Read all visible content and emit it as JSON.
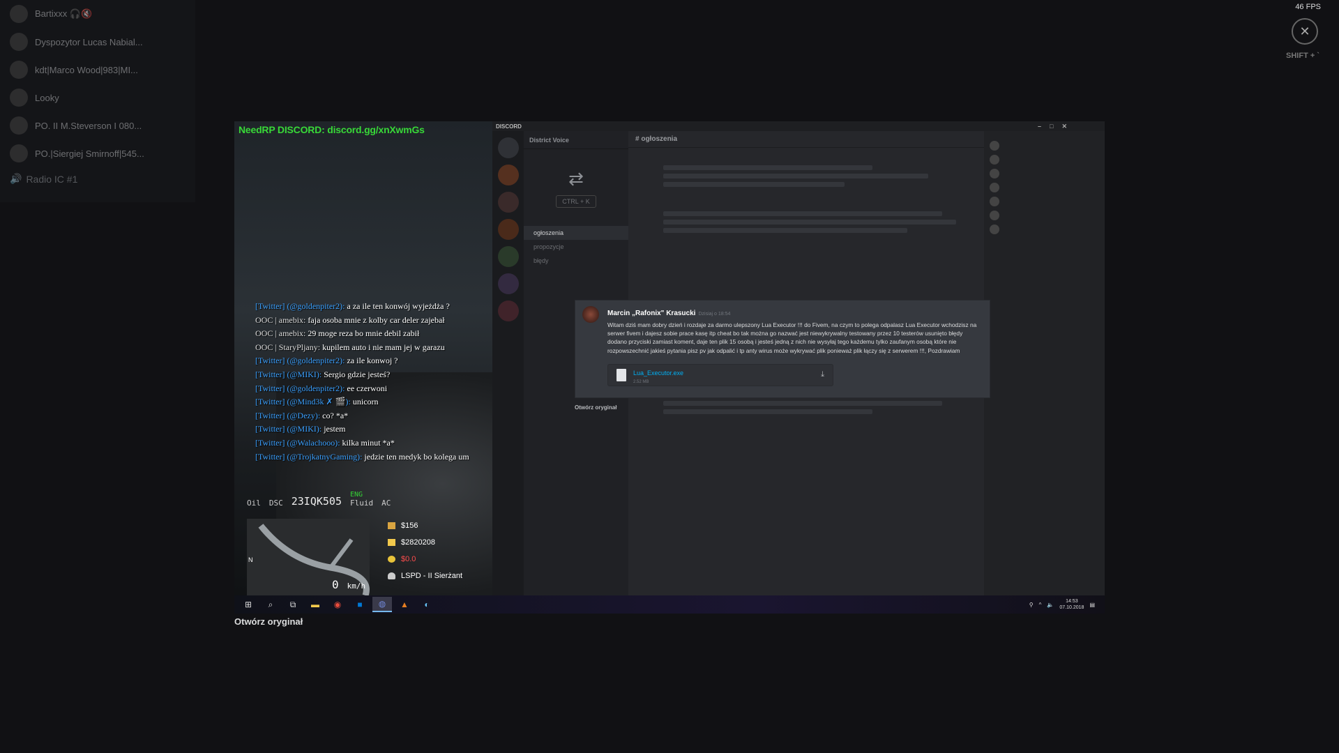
{
  "overlay": {
    "fps": "46 FPS",
    "shift_hint": "SHIFT + `",
    "close_symbol": "✕"
  },
  "voice": {
    "users": [
      {
        "name": "Bartixxx 🎧🔇"
      },
      {
        "name": "Dyspozytor Lucas Nabial..."
      },
      {
        "name": "kdt|Marco Wood|983|MI..."
      },
      {
        "name": "Looky"
      },
      {
        "name": "PO. II M.Steverson I 080..."
      },
      {
        "name": "PO.|Siergiej Smirnoff|545..."
      }
    ],
    "channel": "Radio IC #1"
  },
  "game": {
    "banner": "NeedRP DISCORD: discord.gg/xnXwmGs",
    "chat": [
      {
        "prefix": "[Twitter] (@goldenpiter2):",
        "text": "a za ile ten konwój wyjeżdża ?",
        "type": "tw"
      },
      {
        "prefix": "OOC | amebix:",
        "text": "faja osoba mnie z kolby car deler zajebał",
        "type": "ooc"
      },
      {
        "prefix": "OOC | amebix:",
        "text": "29 moge reza bo mnie debil zabił",
        "type": "ooc"
      },
      {
        "prefix": "OOC | StaryPljany:",
        "text": "kupilem auto i nie mam jej w garazu",
        "type": "ooc"
      },
      {
        "prefix": "[Twitter] (@goldenpiter2):",
        "text": "za ile konwoj ?",
        "type": "tw"
      },
      {
        "prefix": "[Twitter] (@MIKI):",
        "text": "Sergio gdzie jesteś?",
        "type": "tw"
      },
      {
        "prefix": "[Twitter] (@goldenpiter2):",
        "text": "ee czerwoni",
        "type": "tw"
      },
      {
        "prefix": "[Twitter] (@Mind3k ✗ 🎬):",
        "text": "unicorn",
        "type": "tw"
      },
      {
        "prefix": "[Twitter] (@Dezy):",
        "text": "co? *a*",
        "type": "tw"
      },
      {
        "prefix": "[Twitter] (@MIKI):",
        "text": "jestem",
        "type": "tw"
      },
      {
        "prefix": "[Twitter] (@Walachooo):",
        "text": "kilka minut *a*",
        "type": "tw"
      },
      {
        "prefix": "[Twitter] (@TrojkatnyGaming):",
        "text": "jedzie ten medyk bo kolega um",
        "type": "tw"
      }
    ],
    "hud": {
      "oil": "Oil",
      "dsc": "DSC",
      "plate": "23IQK505",
      "eng": "ENG",
      "fluid": "Fluid",
      "ac": "AC",
      "speed": "0",
      "speed_unit": "km/h",
      "compass": "N",
      "cash": "$156",
      "bank": "$2820208",
      "dirty": "$0.0",
      "job": "LSPD - II Sierżant",
      "colors": {
        "cash": "#d9a441",
        "bank": "#f2c94c",
        "dirty": "#ff4d4d"
      }
    }
  },
  "discord": {
    "app_label": "DISCORD",
    "server_name": "District Voice",
    "active_channel": "ogłoszenia",
    "channels": [
      "ogłoszenia",
      "propozycje",
      "błędy"
    ],
    "quick_switcher_shortcut": "CTRL + K"
  },
  "popup": {
    "author": "Marcin „Rafonix\" Krasucki",
    "timestamp": "Dzisiaj o 18:54",
    "body": "Witam dziś mam dobry dzień i rozdaje za darmo ulepszony Lua Executor !!! do Fivem, na czym to polega odpalasz Lua Executor wchodzisz na serwer fivem i dajesz sobie prace kasę itp cheat bo tak można go nazwać jest niewykrywalny testowany przez 10 testerów usunięto błędy dodano przyciski zamiast koment, daje ten plik 15 osobą i jesteś jedną z nich nie wysyłaj tego każdemu tylko zaufanym osobą które nie rozpowszechnić jakieś pytania pisz pv jak odpalić i tp anty wirus może wykrywać plik ponieważ plik łączy się z serwerem !!!, Pozdrawiam",
    "attachment_name": "Lua_Executor.exe",
    "attachment_size": "2.52 MB",
    "open_original": "Otwórz oryginał"
  },
  "taskbar": {
    "time": "14:53",
    "date": "07.10.2018"
  },
  "lightbox": {
    "open_original": "Otwórz oryginał"
  }
}
